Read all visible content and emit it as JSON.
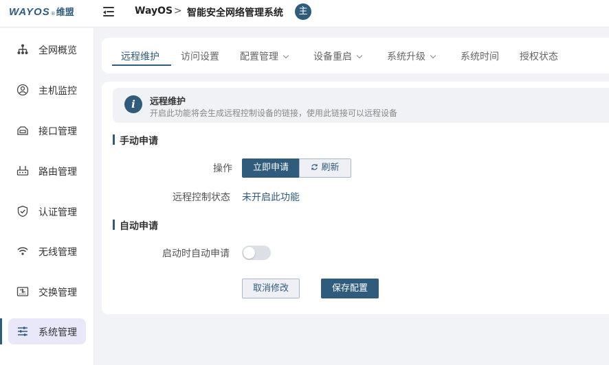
{
  "brand": {
    "logo_text": "WAYOS",
    "logo_reg": "®",
    "logo_cn": "维盟"
  },
  "header": {
    "breadcrumb_root": "WayOS",
    "breadcrumb_sep": ">",
    "breadcrumb_current": "智能安全网络管理系统",
    "avatar_text": "主"
  },
  "sidebar": {
    "items": [
      {
        "label": "全网概览",
        "icon": "network-topology-icon"
      },
      {
        "label": "主机监控",
        "icon": "user-circle-icon"
      },
      {
        "label": "接口管理",
        "icon": "interface-icon"
      },
      {
        "label": "路由管理",
        "icon": "router-icon"
      },
      {
        "label": "认证管理",
        "icon": "shield-check-icon"
      },
      {
        "label": "无线管理",
        "icon": "wifi-icon"
      },
      {
        "label": "交换管理",
        "icon": "switch-icon"
      },
      {
        "label": "系统管理",
        "icon": "sliders-icon",
        "active": true
      }
    ]
  },
  "tabs": [
    {
      "label": "远程维护",
      "active": true
    },
    {
      "label": "访问设置"
    },
    {
      "label": "配置管理",
      "dropdown": true
    },
    {
      "label": "设备重启",
      "dropdown": true
    },
    {
      "label": "系统升级",
      "dropdown": true
    },
    {
      "label": "系统时间"
    },
    {
      "label": "授权状态"
    }
  ],
  "info": {
    "icon_text": "i",
    "title": "远程维护",
    "description": "开启此功能将会生成远程控制设备的链接，使用此链接可以远程设备"
  },
  "manual": {
    "section_title": "手动申请",
    "operation_label": "操作",
    "apply_button": "立即申请",
    "refresh_button": "刷新",
    "status_label": "远程控制状态",
    "status_value": "未开启此功能"
  },
  "auto": {
    "section_title": "自动申请",
    "toggle_label": "启动时自动申请",
    "toggle_on": false
  },
  "footer": {
    "cancel_button": "取消修改",
    "save_button": "保存配置"
  },
  "colors": {
    "accent": "#2f5b7c",
    "background": "#f2f3f7",
    "active_nav_bg": "#e9e8fb",
    "status_text": "#2f5b7c"
  }
}
